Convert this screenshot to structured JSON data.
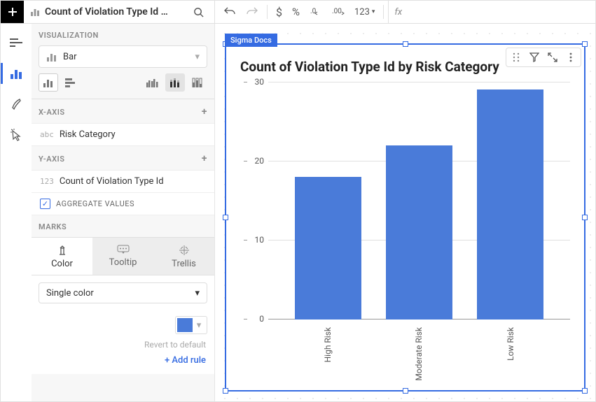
{
  "header": {
    "title": "Count of Violation Type Id …"
  },
  "toolbar": {
    "number_format": "123",
    "fx": "fx"
  },
  "visualization": {
    "header": "VISUALIZATION",
    "chart_type": "Bar",
    "x_axis_header": "X-AXIS",
    "x_pill_type": "abc",
    "x_pill": "Risk Category",
    "y_axis_header": "Y-AXIS",
    "y_pill_type": "123",
    "y_pill": "Count of Violation Type Id",
    "aggregate_label": "AGGREGATE VALUES",
    "marks_header": "MARKS",
    "tab_color": "Color",
    "tab_tooltip": "Tooltip",
    "tab_trellis": "Trellis",
    "color_mode": "Single color",
    "revert": "Revert to default",
    "add_rule": "+  Add rule"
  },
  "chart": {
    "tag": "Sigma Docs",
    "title": "Count of Violation Type Id by Risk Category"
  },
  "chart_data": {
    "type": "bar",
    "title": "Count of Violation Type Id by Risk Category",
    "xlabel": "",
    "ylabel": "",
    "categories": [
      "High Risk",
      "Moderate Risk",
      "Low Risk"
    ],
    "values": [
      18,
      22,
      29
    ],
    "y_ticks": [
      0,
      10,
      20,
      30
    ],
    "ylim": [
      0,
      30
    ],
    "color": "#4a7bd9"
  }
}
